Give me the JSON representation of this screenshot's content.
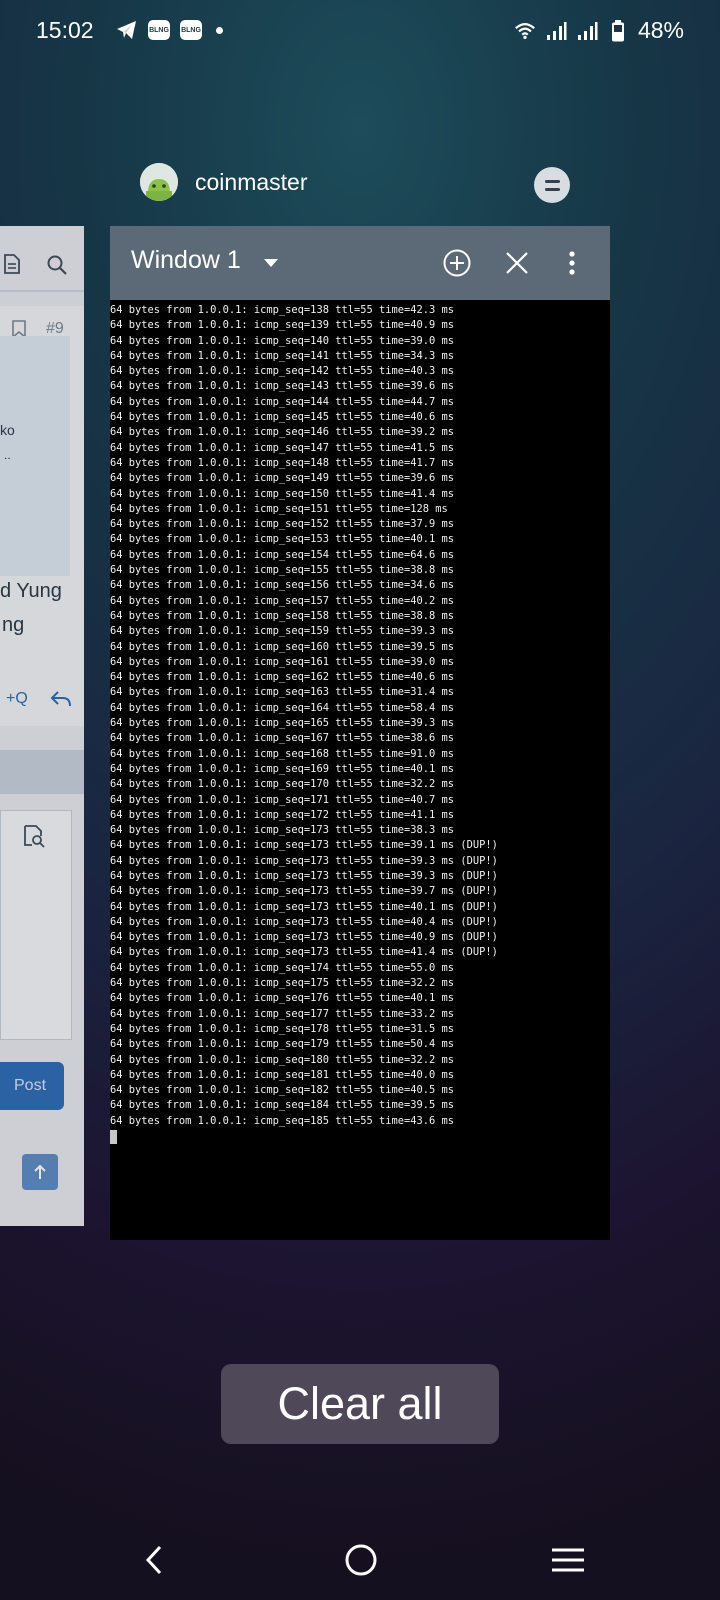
{
  "status_bar": {
    "time": "15:02",
    "battery": "48%",
    "icons": [
      "telegram-icon",
      "notification-app-icon",
      "notification-app-icon",
      "dot-icon",
      "wifi-icon",
      "signal-icon",
      "signal-icon",
      "battery-icon"
    ],
    "notif_app_label": "BLNG"
  },
  "recent_app": {
    "name": "coinmaster",
    "icon": "android-icon"
  },
  "left_card": {
    "hash_label": "#9",
    "text1": "ko",
    "text2": "..",
    "text3": "d Yung",
    "text4": "ng",
    "quote_label": "+Q",
    "post_label": "Post"
  },
  "terminal_window": {
    "title": "Window 1",
    "lines": [
      "64 bytes from 1.0.0.1: icmp_seq=138 ttl=55 time=42.3 ms",
      "64 bytes from 1.0.0.1: icmp_seq=139 ttl=55 time=40.9 ms",
      "64 bytes from 1.0.0.1: icmp_seq=140 ttl=55 time=39.0 ms",
      "64 bytes from 1.0.0.1: icmp_seq=141 ttl=55 time=34.3 ms",
      "64 bytes from 1.0.0.1: icmp_seq=142 ttl=55 time=40.3 ms",
      "64 bytes from 1.0.0.1: icmp_seq=143 ttl=55 time=39.6 ms",
      "64 bytes from 1.0.0.1: icmp_seq=144 ttl=55 time=44.7 ms",
      "64 bytes from 1.0.0.1: icmp_seq=145 ttl=55 time=40.6 ms",
      "64 bytes from 1.0.0.1: icmp_seq=146 ttl=55 time=39.2 ms",
      "64 bytes from 1.0.0.1: icmp_seq=147 ttl=55 time=41.5 ms",
      "64 bytes from 1.0.0.1: icmp_seq=148 ttl=55 time=41.7 ms",
      "64 bytes from 1.0.0.1: icmp_seq=149 ttl=55 time=39.6 ms",
      "64 bytes from 1.0.0.1: icmp_seq=150 ttl=55 time=41.4 ms",
      "64 bytes from 1.0.0.1: icmp_seq=151 ttl=55 time=128 ms",
      "64 bytes from 1.0.0.1: icmp_seq=152 ttl=55 time=37.9 ms",
      "64 bytes from 1.0.0.1: icmp_seq=153 ttl=55 time=40.1 ms",
      "64 bytes from 1.0.0.1: icmp_seq=154 ttl=55 time=64.6 ms",
      "64 bytes from 1.0.0.1: icmp_seq=155 ttl=55 time=38.8 ms",
      "64 bytes from 1.0.0.1: icmp_seq=156 ttl=55 time=34.6 ms",
      "64 bytes from 1.0.0.1: icmp_seq=157 ttl=55 time=40.2 ms",
      "64 bytes from 1.0.0.1: icmp_seq=158 ttl=55 time=38.8 ms",
      "64 bytes from 1.0.0.1: icmp_seq=159 ttl=55 time=39.3 ms",
      "64 bytes from 1.0.0.1: icmp_seq=160 ttl=55 time=39.5 ms",
      "64 bytes from 1.0.0.1: icmp_seq=161 ttl=55 time=39.0 ms",
      "64 bytes from 1.0.0.1: icmp_seq=162 ttl=55 time=40.6 ms",
      "64 bytes from 1.0.0.1: icmp_seq=163 ttl=55 time=31.4 ms",
      "64 bytes from 1.0.0.1: icmp_seq=164 ttl=55 time=58.4 ms",
      "64 bytes from 1.0.0.1: icmp_seq=165 ttl=55 time=39.3 ms",
      "64 bytes from 1.0.0.1: icmp_seq=167 ttl=55 time=38.6 ms",
      "64 bytes from 1.0.0.1: icmp_seq=168 ttl=55 time=91.0 ms",
      "64 bytes from 1.0.0.1: icmp_seq=169 ttl=55 time=40.1 ms",
      "64 bytes from 1.0.0.1: icmp_seq=170 ttl=55 time=32.2 ms",
      "64 bytes from 1.0.0.1: icmp_seq=171 ttl=55 time=40.7 ms",
      "64 bytes from 1.0.0.1: icmp_seq=172 ttl=55 time=41.1 ms",
      "64 bytes from 1.0.0.1: icmp_seq=173 ttl=55 time=38.3 ms",
      "64 bytes from 1.0.0.1: icmp_seq=173 ttl=55 time=39.1 ms (DUP!)",
      "64 bytes from 1.0.0.1: icmp_seq=173 ttl=55 time=39.3 ms (DUP!)",
      "64 bytes from 1.0.0.1: icmp_seq=173 ttl=55 time=39.3 ms (DUP!)",
      "64 bytes from 1.0.0.1: icmp_seq=173 ttl=55 time=39.7 ms (DUP!)",
      "64 bytes from 1.0.0.1: icmp_seq=173 ttl=55 time=40.1 ms (DUP!)",
      "64 bytes from 1.0.0.1: icmp_seq=173 ttl=55 time=40.4 ms (DUP!)",
      "64 bytes from 1.0.0.1: icmp_seq=173 ttl=55 time=40.9 ms (DUP!)",
      "64 bytes from 1.0.0.1: icmp_seq=173 ttl=55 time=41.4 ms (DUP!)",
      "64 bytes from 1.0.0.1: icmp_seq=174 ttl=55 time=55.0 ms",
      "64 bytes from 1.0.0.1: icmp_seq=175 ttl=55 time=32.2 ms",
      "64 bytes from 1.0.0.1: icmp_seq=176 ttl=55 time=40.1 ms",
      "64 bytes from 1.0.0.1: icmp_seq=177 ttl=55 time=33.2 ms",
      "64 bytes from 1.0.0.1: icmp_seq=178 ttl=55 time=31.5 ms",
      "64 bytes from 1.0.0.1: icmp_seq=179 ttl=55 time=50.4 ms",
      "64 bytes from 1.0.0.1: icmp_seq=180 ttl=55 time=32.2 ms",
      "64 bytes from 1.0.0.1: icmp_seq=181 ttl=55 time=40.0 ms",
      "64 bytes from 1.0.0.1: icmp_seq=182 ttl=55 time=40.5 ms",
      "64 bytes from 1.0.0.1: icmp_seq=184 ttl=55 time=39.5 ms",
      "64 bytes from 1.0.0.1: icmp_seq=185 ttl=55 time=43.6 ms"
    ],
    "toolbar_icons": [
      "add-window-icon",
      "close-icon",
      "more-vert-icon"
    ]
  },
  "clear_all_label": "Clear all",
  "nav_bar": {
    "icons": [
      "back-icon",
      "home-icon",
      "recents-icon"
    ]
  },
  "colors": {
    "toolbar": "#5b6a76",
    "terminal_bg": "#000000",
    "clear_all_bg": "#4e4858"
  }
}
